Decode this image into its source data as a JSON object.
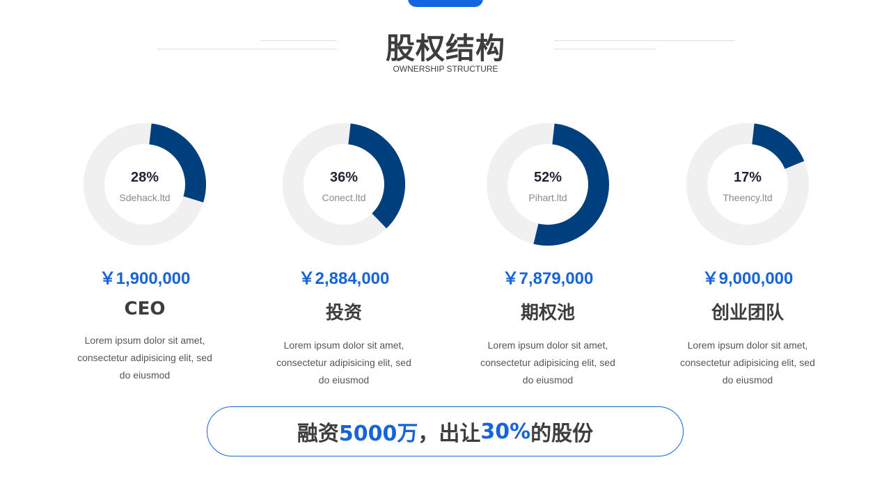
{
  "header": {
    "title": "股权结构",
    "subtitle": "OWNERSHIP STRUCTURE"
  },
  "colors": {
    "accent": "#1565d8",
    "donut_fill": "#003f7d",
    "donut_track": "#f0f0f0",
    "text_dark": "#3d3d3d"
  },
  "chart_data": [
    {
      "type": "pie",
      "percent": 28,
      "percent_label": "28%",
      "company": "Sdehack.ltd"
    },
    {
      "type": "pie",
      "percent": 36,
      "percent_label": "36%",
      "company": "Conect.ltd"
    },
    {
      "type": "pie",
      "percent": 52,
      "percent_label": "52%",
      "company": "Pihart.ltd"
    },
    {
      "type": "pie",
      "percent": 17,
      "percent_label": "17%",
      "company": "Theency.ltd"
    }
  ],
  "cards": [
    {
      "amount": "￥1,900,000",
      "role": "CEO",
      "desc": "Lorem ipsum dolor sit amet, consectetur adipisicing elit, sed do eiusmod"
    },
    {
      "amount": "￥2,884,000",
      "role": "投资",
      "desc": "Lorem ipsum dolor sit amet, consectetur adipisicing elit, sed do eiusmod"
    },
    {
      "amount": "￥7,879,000",
      "role": "期权池",
      "desc": "Lorem ipsum dolor sit amet, consectetur adipisicing elit, sed do eiusmod"
    },
    {
      "amount": "￥9,000,000",
      "role": "创业团队",
      "desc": "Lorem ipsum dolor sit amet, consectetur adipisicing elit, sed do eiusmod"
    }
  ],
  "banner": {
    "part1": "融资",
    "amount": "5000万",
    "part2": "，出让",
    "percent": "30%",
    "part3": "的股份"
  }
}
